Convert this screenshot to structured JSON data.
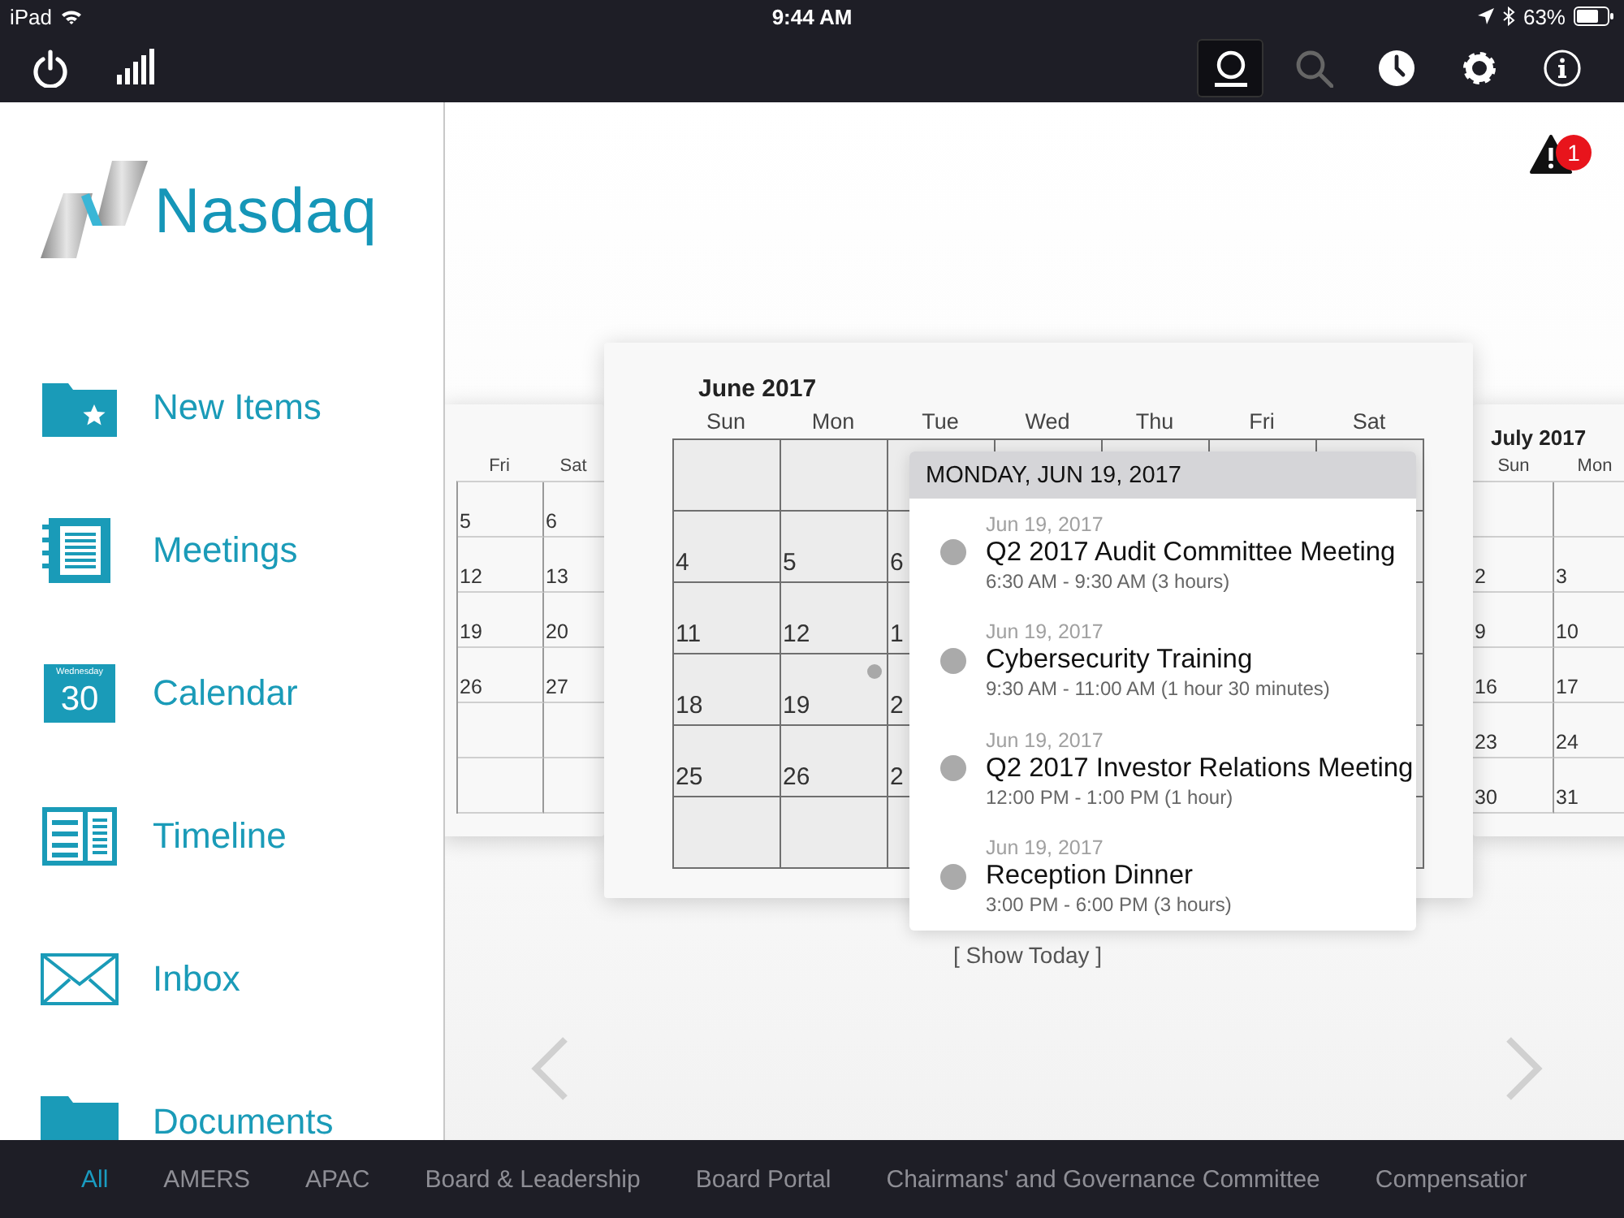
{
  "status_bar": {
    "device": "iPad",
    "time": "9:44 AM",
    "battery": "63%"
  },
  "toolbar": {
    "left_buttons": [
      {
        "kind": "power"
      },
      {
        "kind": "signal"
      }
    ],
    "right_buttons": [
      {
        "kind": "profile",
        "selected": true,
        "disabled": false
      },
      {
        "kind": "search",
        "selected": false,
        "disabled": true
      },
      {
        "kind": "history",
        "selected": false,
        "disabled": false
      },
      {
        "kind": "settings",
        "selected": false,
        "disabled": false
      },
      {
        "kind": "info",
        "selected": false,
        "disabled": false
      }
    ]
  },
  "sidebar": {
    "logo": "Nasdaq",
    "items": [
      {
        "kind": "new-items",
        "label": "New Items"
      },
      {
        "kind": "meetings",
        "label": "Meetings"
      },
      {
        "kind": "calendar",
        "label": "Calendar",
        "icon_weekday": "Wednesday",
        "icon_day": "30"
      },
      {
        "kind": "timeline",
        "label": "Timeline"
      },
      {
        "kind": "inbox",
        "label": "Inbox"
      },
      {
        "kind": "documents",
        "label": "Documents"
      }
    ]
  },
  "alerts": {
    "badge": "1"
  },
  "calendar": {
    "previous_month": {
      "weekdays": [
        "Fri",
        "Sat"
      ],
      "weeks": [
        {
          "kind": "dates",
          "days": [
            "5",
            "6"
          ]
        },
        {
          "kind": "dates",
          "days": [
            "12",
            "13"
          ]
        },
        {
          "kind": "dates",
          "days": [
            "19",
            "20"
          ]
        },
        {
          "kind": "dates",
          "days": [
            "26",
            "27"
          ]
        },
        {
          "kind": "empty"
        },
        {
          "kind": "empty"
        }
      ]
    },
    "current_month": {
      "title": "June 2017",
      "weekdays": [
        "Sun",
        "Mon",
        "Tue",
        "Wed",
        "Thu",
        "Fri",
        "Sat"
      ],
      "weeks": [
        {
          "kind": "empty"
        },
        {
          "kind": "dates",
          "days": [
            {
              "day": "4",
              "has_events": false
            },
            {
              "day": "5",
              "has_events": false
            },
            {
              "day": "6",
              "has_events": false
            }
          ]
        },
        {
          "kind": "dates",
          "days": [
            {
              "day": "11",
              "has_events": false
            },
            {
              "day": "12",
              "has_events": false
            },
            {
              "day": "1",
              "has_events": false
            }
          ]
        },
        {
          "kind": "dates",
          "days": [
            {
              "day": "18",
              "has_events": false
            },
            {
              "day": "19",
              "has_events": true
            },
            {
              "day": "2",
              "has_events": false
            }
          ]
        },
        {
          "kind": "dates",
          "days": [
            {
              "day": "25",
              "has_events": false
            },
            {
              "day": "26",
              "has_events": false
            },
            {
              "day": "2",
              "has_events": false
            }
          ]
        },
        {
          "kind": "empty"
        }
      ]
    },
    "next_month": {
      "title": "July 2017",
      "weekdays": [
        "Sun",
        "Mon"
      ],
      "weeks": [
        {
          "kind": "empty"
        },
        {
          "kind": "dates",
          "days": [
            "2",
            "3"
          ]
        },
        {
          "kind": "dates",
          "days": [
            "9",
            "10"
          ]
        },
        {
          "kind": "dates",
          "days": [
            "16",
            "17"
          ]
        },
        {
          "kind": "dates",
          "days": [
            "23",
            "24"
          ]
        },
        {
          "kind": "dates",
          "days": [
            "30",
            "31"
          ]
        }
      ]
    },
    "day_popover": {
      "heading": "MONDAY, JUN 19, 2017",
      "events": [
        {
          "date": "Jun 19, 2017",
          "title": "Q2 2017 Audit Committee Meeting",
          "time": "6:30 AM - 9:30 AM (3 hours)"
        },
        {
          "date": "Jun 19, 2017",
          "title": "Cybersecurity Training",
          "time": "9:30 AM - 11:00 AM (1 hour 30 minutes)"
        },
        {
          "date": "Jun 19, 2017",
          "title": "Q2 2017 Investor Relations Meeting",
          "time": "12:00 PM - 1:00 PM (1 hour)"
        },
        {
          "date": "Jun 19, 2017",
          "title": "Reception Dinner",
          "time": "3:00 PM - 6:00 PM (3 hours)"
        }
      ]
    },
    "show_today": "[ Show Today ]"
  },
  "bottom_tabs": [
    {
      "label": "All",
      "selected": true
    },
    {
      "label": "AMERS",
      "selected": false
    },
    {
      "label": "APAC",
      "selected": false
    },
    {
      "label": "Board & Leadership",
      "selected": false
    },
    {
      "label": "Board Portal",
      "selected": false
    },
    {
      "label": "Chairmans' and Governance Committee",
      "selected": false
    },
    {
      "label": "Compensatior",
      "selected": false
    }
  ]
}
